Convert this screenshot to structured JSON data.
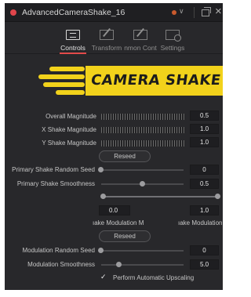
{
  "window": {
    "title": "AdvancedCameraShake_16"
  },
  "tabs": [
    {
      "label": "Controls",
      "icon": "controls-icon",
      "active": true
    },
    {
      "label": "Transform",
      "icon": "transform-icon",
      "active": false
    },
    {
      "label": "nmon Cont",
      "icon": "common-controls-icon",
      "active": false
    },
    {
      "label": "Settings",
      "icon": "settings-icon",
      "active": false
    }
  ],
  "banner": {
    "text": "CAMERA SHAKE",
    "color": "#f2d21b"
  },
  "controls": {
    "overall_magnitude": {
      "label": "Overall Magnitude",
      "value": "0.5"
    },
    "x_shake_magnitude": {
      "label": "X Shake Magnitude",
      "value": "1.0"
    },
    "y_shake_magnitude": {
      "label": "Y Shake Magnitude",
      "value": "1.0"
    },
    "reseed_button": "Reseed",
    "primary_shake_random_seed": {
      "label": "Primary Shake Random Seed",
      "value": "0"
    },
    "primary_shake_smoothness": {
      "label": "Primary Shake Smoothness",
      "value": "0.5",
      "level": 0.5
    },
    "shake_modulation_range": {
      "low": "0.0",
      "high": "1.0",
      "label_low": "ıake Modulation M",
      "label_high": "ıake Modulation"
    },
    "modulation_reseed_button": "Reseed",
    "modulation_random_seed": {
      "label": "Modulation Random Seed",
      "value": "0"
    },
    "modulation_smoothness": {
      "label": "Modulation Smoothness",
      "value": "5.0",
      "level": 0.21
    },
    "perform_automatic_upscaling": {
      "label": "Perform Automatic Upscaling",
      "checked": true,
      "check_glyph": "✓"
    }
  }
}
